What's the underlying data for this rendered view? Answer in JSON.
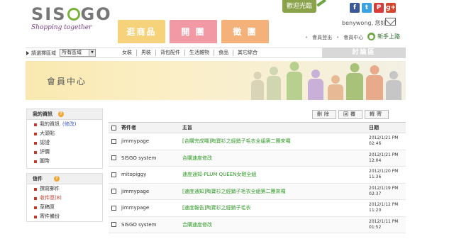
{
  "header": {
    "logo_part1": "SIS",
    "logo_part2": "GO",
    "tagline": "Shopping together",
    "tabs": [
      "逛商品",
      "開 團",
      "徵 團"
    ],
    "welcome": "歡迎光臨",
    "social": {
      "fb": "f",
      "tw": "t",
      "pl": "P",
      "gp": "g+"
    },
    "greeting": "benywong, 您好",
    "top_links": [
      "會員登出",
      "會員中心"
    ],
    "new_guide": "新手上路"
  },
  "navbar": {
    "region_label": "請選擇區域",
    "region_value": "所有區域",
    "categories": [
      "女裝",
      "男裝",
      "背包配件",
      "生活雜物",
      "食品",
      "其它綜合"
    ],
    "forum": "討論區"
  },
  "banner": {
    "title": "會員中心"
  },
  "sidebar": {
    "my_info": {
      "title": "我的資訊",
      "badge": "?",
      "items": [
        {
          "label": "我的資訊",
          "action": "(修改)"
        },
        {
          "label": "大頭貼"
        },
        {
          "label": "認證"
        },
        {
          "label": "評價"
        },
        {
          "label": "圖幣"
        }
      ]
    },
    "mail": {
      "title": "信件",
      "badge": "?",
      "items": [
        {
          "label": "撰寫郵件"
        },
        {
          "label": "收件匣",
          "count": "(8)"
        },
        {
          "label": "草稿匣"
        },
        {
          "label": "寄件備份"
        }
      ]
    }
  },
  "toolbar": {
    "buttons": [
      "刪除",
      "回覆",
      "轉寄"
    ]
  },
  "table": {
    "headers": {
      "sender": "寄件者",
      "subject": "主旨",
      "date": "日期"
    },
    "rows": [
      {
        "sender": "jimmypage",
        "subject": "[合購完成囉]陶寶衫之經銷子毛衣全組第二團來囉",
        "date": "2012/1/21 PM 02:46"
      },
      {
        "sender": "SISGO system",
        "subject": "合購速度修改",
        "date": "2012/1/21 PM 12:04"
      },
      {
        "sender": "mitopiggy",
        "subject": "速度通知-PLUM QUEEN女鞋全組",
        "date": "2012/1/20 PM 11:36"
      },
      {
        "sender": "jimmypage",
        "subject": "[速度通知]陶寶衫之經銷子毛衣全組第二團來囉",
        "date": "2012/1/19 PM 02:37"
      },
      {
        "sender": "jimmypage",
        "subject": "[速度報告]陶寶衫之經銷子毛衣",
        "date": "2012/1/12 PM 11:20"
      },
      {
        "sender": "SISGO system",
        "subject": "合購速度修改",
        "date": "2012/1/11 PM 01:52"
      }
    ]
  }
}
